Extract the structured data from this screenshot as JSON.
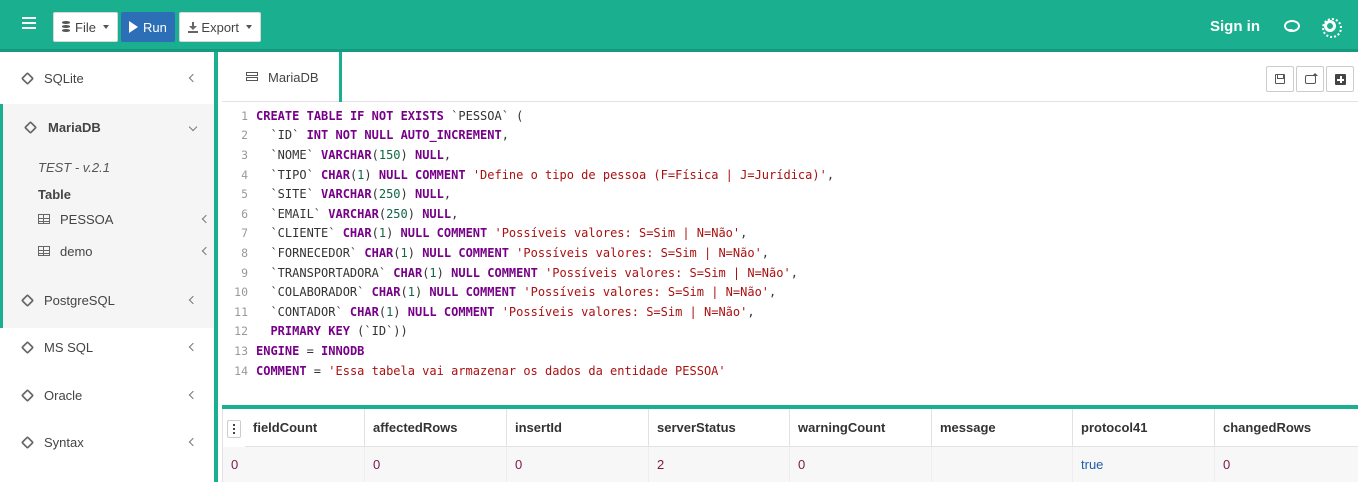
{
  "toolbar": {
    "file_label": "File",
    "run_label": "Run",
    "export_label": "Export",
    "signin_label": "Sign in"
  },
  "sidebar": {
    "items": [
      {
        "label": "SQLite"
      },
      {
        "label": "MariaDB",
        "expanded": true
      },
      {
        "label": "PostgreSQL"
      },
      {
        "label": "MS SQL"
      },
      {
        "label": "Oracle"
      },
      {
        "label": "Syntax"
      }
    ],
    "mariadb": {
      "version": "TEST - v.2.1",
      "table_heading": "Table",
      "tables": [
        "PESSOA",
        "demo"
      ]
    }
  },
  "editor": {
    "tab_label": "MariaDB",
    "line_numbers": [
      "1",
      "2",
      "3",
      "4",
      "5",
      "6",
      "7",
      "8",
      "9",
      "10",
      "11",
      "12",
      "13",
      "14"
    ],
    "lines": [
      "CREATE TABLE IF NOT EXISTS `PESSOA` (",
      "  `ID` INT NOT NULL AUTO_INCREMENT,",
      "  `NOME` VARCHAR(150) NULL,",
      "  `TIPO` CHAR(1) NULL COMMENT 'Define o tipo de pessoa (F=Física | J=Jurídica)',",
      "  `SITE` VARCHAR(250) NULL,",
      "  `EMAIL` VARCHAR(250) NULL,",
      "  `CLIENTE` CHAR(1) NULL COMMENT 'Possíveis valores: S=Sim | N=Não',",
      "  `FORNECEDOR` CHAR(1) NULL COMMENT 'Possíveis valores: S=Sim | N=Não',",
      "  `TRANSPORTADORA` CHAR(1) NULL COMMENT 'Possíveis valores: S=Sim | N=Não',",
      "  `COLABORADOR` CHAR(1) NULL COMMENT 'Possíveis valores: S=Sim | N=Não',",
      "  `CONTADOR` CHAR(1) NULL COMMENT 'Possíveis valores: S=Sim | N=Não',",
      "  PRIMARY KEY (`ID`))",
      "ENGINE = INNODB",
      "COMMENT = 'Essa tabela vai armazenar os dados da entidade PESSOA'"
    ]
  },
  "results": {
    "columns": [
      "fieldCount",
      "affectedRows",
      "insertId",
      "serverStatus",
      "warningCount",
      "message",
      "protocol41",
      "changedRows"
    ],
    "row": [
      "0",
      "0",
      "0",
      "2",
      "0",
      "",
      "true",
      "0"
    ]
  },
  "colors": {
    "accent": "#1aaf8f",
    "run_button": "#2d6fb6"
  }
}
